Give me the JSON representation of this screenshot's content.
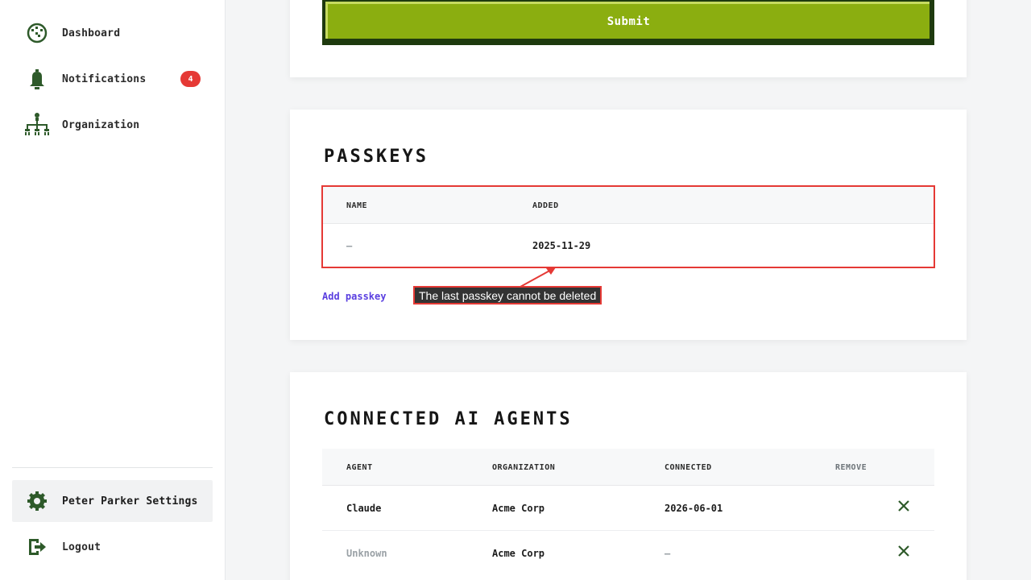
{
  "sidebar": {
    "items": [
      {
        "label": "Dashboard",
        "icon": "dashboard-icon"
      },
      {
        "label": "Notifications",
        "icon": "bell-icon",
        "badge": "4"
      },
      {
        "label": "Organization",
        "icon": "org-chart-icon"
      }
    ],
    "settings_label": "Peter Parker Settings",
    "logout_label": "Logout"
  },
  "form": {
    "submit_label": "Submit"
  },
  "passkeys": {
    "title": "Passkeys",
    "columns": [
      "Name",
      "Added"
    ],
    "rows": [
      {
        "name": "–",
        "added": "2025-11-29"
      }
    ],
    "add_label": "Add passkey",
    "tooltip": "The last passkey cannot be deleted"
  },
  "agents": {
    "title": "Connected AI Agents",
    "columns": [
      "Agent",
      "Organization",
      "Connected",
      "Remove"
    ],
    "rows": [
      {
        "agent": "Claude",
        "organization": "Acme Corp",
        "connected": "2026-06-01"
      },
      {
        "agent": "Unknown",
        "organization": "Acme Corp",
        "connected": "–"
      }
    ]
  },
  "colors": {
    "accent_green": "#8bae10",
    "dark_green": "#2e5a2a",
    "badge_red": "#e53935",
    "link_purple": "#5a3fe0"
  }
}
